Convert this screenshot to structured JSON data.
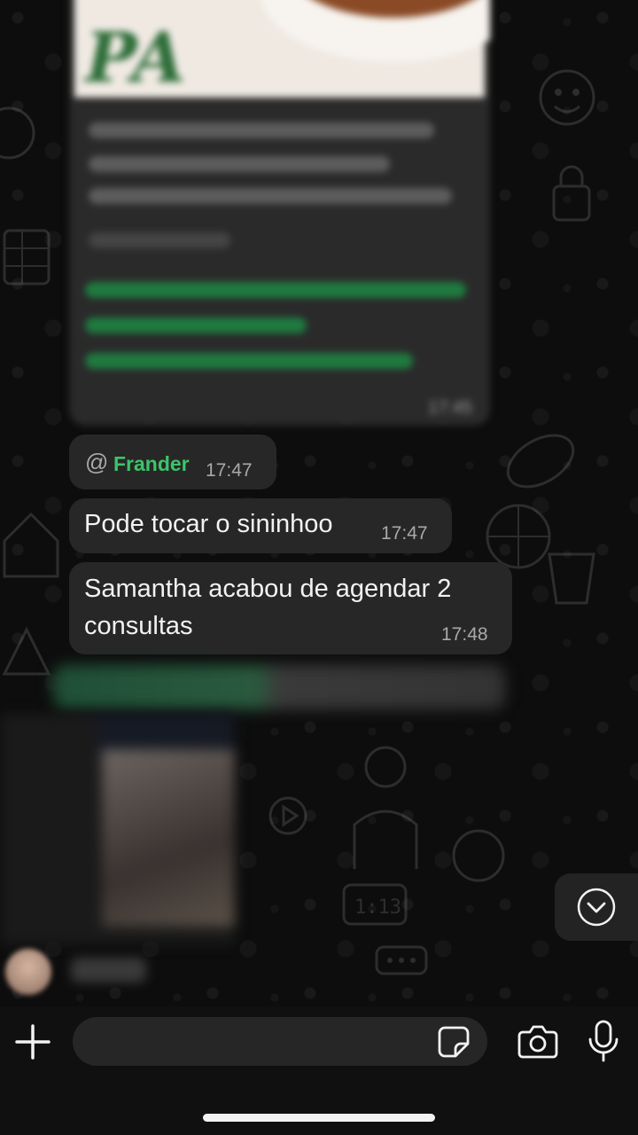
{
  "messages": [
    {
      "type": "mention",
      "at_symbol": "@",
      "name": "Frander",
      "time": "17:47"
    },
    {
      "type": "text",
      "text": "Pode tocar o sininhoo",
      "time": "17:47"
    },
    {
      "type": "text",
      "line1": "Samantha acabou de agendar 2",
      "line2": "consultas",
      "time": "17:48"
    }
  ],
  "blurred_card": {
    "time": "17:45"
  },
  "composer": {
    "placeholder": ""
  },
  "icons": {
    "attach": "plus-icon",
    "sticker": "sticker-icon",
    "camera": "camera-icon",
    "mic": "microphone-icon",
    "scroll": "chevron-down-icon"
  },
  "colors": {
    "mention": "#3cc46a",
    "bubble": "#272727",
    "background": "#0b0b0b"
  }
}
